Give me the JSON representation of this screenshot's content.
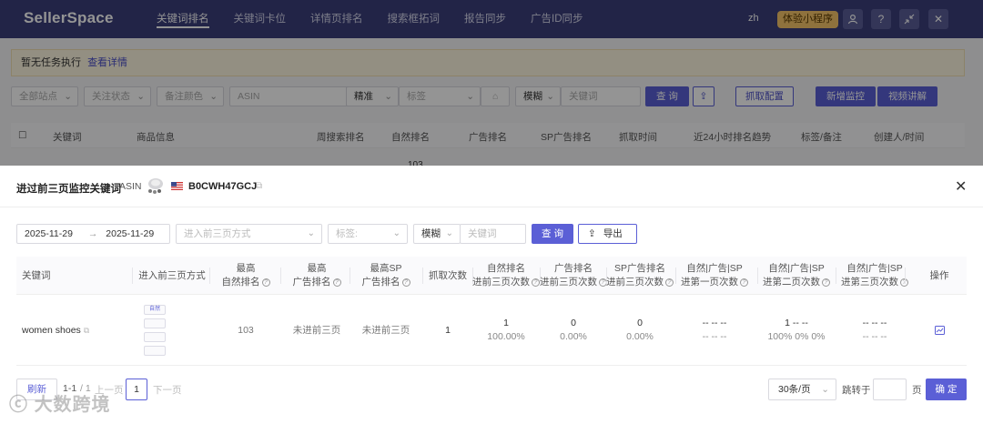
{
  "nav": {
    "logo": "SellerSpace",
    "items": [
      "关键词排名",
      "关键词卡位",
      "详情页排名",
      "搜索框拓词",
      "报告同步",
      "广告ID同步"
    ],
    "lang": "zh",
    "miniprogram": "体验小程序"
  },
  "page": {
    "notice_text": "暂无任务执行",
    "notice_link": "查看详情",
    "filters": {
      "site": "全部站点",
      "follow": "关注状态",
      "color": "备注颜色",
      "asin_placeholder": "ASIN",
      "precise": "精准",
      "tag_placeholder": "标签",
      "fuzzy": "模糊",
      "keyword_placeholder": "关键词",
      "query": "查 询",
      "fetch_config": "抓取配置",
      "add_monitor": "新增监控",
      "video": "视频讲解"
    },
    "table_headers": [
      "关键词",
      "商品信息",
      "周搜索排名",
      "自然排名",
      "广告排名",
      "SP广告排名",
      "抓取时间",
      "近24小时排名趋势",
      "标签/备注",
      "创建人/时间"
    ],
    "first_row_value": "103"
  },
  "modal": {
    "title": "进过前三页监控关键词",
    "asin_label": "ASIN",
    "asin_value": "B0CWH47GCJ",
    "date_start": "2025-11-29",
    "date_end": "2025-11-29",
    "date_arrow": "→",
    "method_placeholder": "进入前三页方式",
    "tag_placeholder": "标签:",
    "fuzzy": "模糊",
    "keyword_placeholder": "关键词",
    "query": "查 询",
    "export": "导出",
    "headers": {
      "keyword": "关键词",
      "method": "进入前三页方式",
      "best_organic": [
        "最高",
        "自然排名"
      ],
      "best_ad": [
        "最高",
        "广告排名"
      ],
      "best_sp": [
        "最高SP",
        "广告排名"
      ],
      "fetch_count": "抓取次数",
      "organic_top3": [
        "自然排名",
        "进前三页次数"
      ],
      "ad_top3": [
        "广告排名",
        "进前三页次数"
      ],
      "sp_top3": [
        "SP广告排名",
        "进前三页次数"
      ],
      "p1": [
        "自然|广告|SP",
        "进第一页次数"
      ],
      "p2": [
        "自然|广告|SP",
        "进第二页次数"
      ],
      "p3": [
        "自然|广告|SP",
        "进第三页次数"
      ],
      "action": "操作"
    },
    "rows": [
      {
        "keyword": "women shoes",
        "method_tags": [
          "自然",
          "",
          "",
          ""
        ],
        "best_organic": "103",
        "best_ad": "未进前三页",
        "best_sp": "未进前三页",
        "fetch_count": "1",
        "organic_top3": "1",
        "organic_top3_pct": "100.00%",
        "ad_top3": "0",
        "ad_top3_pct": "0.00%",
        "sp_top3": "0",
        "sp_top3_pct": "0.00%",
        "p1": "-- -- --",
        "p1_pct": "-- -- --",
        "p2": "1 -- --",
        "p2_pct": "100%  0%  0%",
        "p3": "-- -- --",
        "p3_pct": "-- -- --"
      }
    ],
    "pager": {
      "refresh": "刷新",
      "range": "1-1",
      "total": "/ 1",
      "prev": "上一页",
      "current": "1",
      "next": "下一页",
      "page_size": "30条/页",
      "jump_label": "跳转于",
      "page_unit": "页",
      "confirm": "确 定"
    },
    "watermark": "大数跨境"
  },
  "colors": {
    "nav_bg": "#3b3e7a",
    "primary": "#5b5fd6",
    "notice_bg": "#fdf6e0"
  }
}
